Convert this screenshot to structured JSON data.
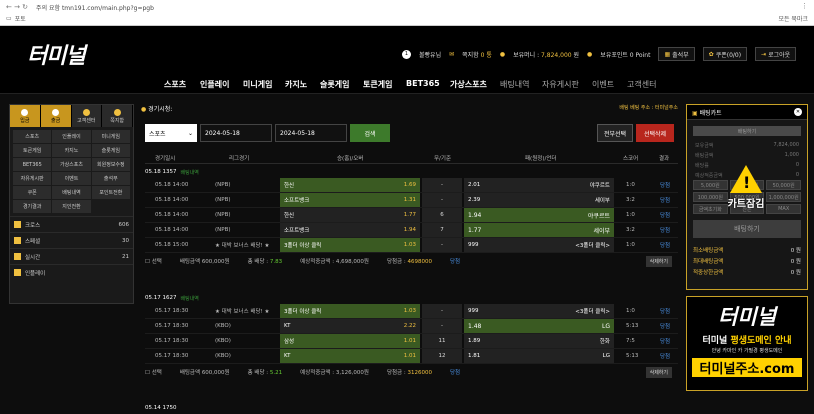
{
  "browser": {
    "url": "주의 요함   tmn191.com/main.php?g=pgb",
    "bookmark": "포토",
    "bookmark_right": "모든 북마크"
  },
  "header": {
    "logo": "터미널",
    "level": "1",
    "user": "볼빵유",
    "user_suffix": "님",
    "msg_label": "쪽지함",
    "msg_count": "0 통",
    "money_label": "보유머니 :",
    "money": "7,824,000",
    "money_unit": "원",
    "point_label": "보유포인트 0 Point",
    "buttons": [
      "출석부",
      "쿠폰(0/0)",
      "로그아웃"
    ]
  },
  "menu": {
    "items": [
      "스포츠",
      "인플레이",
      "미니게임",
      "카지노",
      "슬롯게임",
      "토큰게임",
      "BET365",
      "가상스포츠",
      "배팅내역",
      "자유게시판",
      "이벤트",
      "고객센터"
    ]
  },
  "sidebar": {
    "top": [
      "입금",
      "출금",
      "고객센터",
      "쪽지함"
    ],
    "grid": [
      "스포츠",
      "인플레이",
      "미니게임",
      "토큰게임",
      "카지노",
      "슬롯게임",
      "BET365",
      "가상스포츠",
      "회원정보수정",
      "자유게시판",
      "이벤트",
      "출석부",
      "쿠폰",
      "배팅내역",
      "포인트전환",
      "경기결과",
      "지인전환"
    ],
    "list": [
      {
        "label": "크로스",
        "count": "606"
      },
      {
        "label": "스페셜",
        "count": "30"
      },
      {
        "label": "실시간",
        "count": "21"
      },
      {
        "label": "인플레이",
        "count": ""
      }
    ]
  },
  "main": {
    "title_prefix": "경기시청:",
    "title_suffix": "",
    "notice": "배팅 베팅 주소 : 터미널주소",
    "filter": {
      "sport": "스포츠",
      "date_from": "2024-05-18",
      "date_to": "2024-05-18",
      "search": "검색",
      "select_all": "전부선택",
      "delete_selected": "선택삭제"
    },
    "columns": [
      "경기일시",
      "리그경기",
      "승(홈)/오버",
      "무/기준",
      "패(원정)/언더",
      "스코어",
      "결과"
    ],
    "groups": [
      {
        "title": "05.18 1357",
        "badge": "배팅내역",
        "rows": [
          {
            "date": "05.18 14:00",
            "league": "(NPB)",
            "home": "한신",
            "ho": "1.69",
            "draw": "-",
            "away": "2.01",
            "aname": "야쿠르트",
            "score": "1:0",
            "res": "당첨",
            "sel": "home"
          },
          {
            "date": "05.18 14:00",
            "league": "(NPB)",
            "home": "소프트뱅크",
            "ho": "1.31",
            "draw": "-",
            "away": "2.39",
            "aname": "세이부",
            "score": "3:2",
            "res": "당첨",
            "sel": "home"
          },
          {
            "date": "05.18 14:00",
            "league": "(NPB)",
            "home": "한신",
            "ho": "1.77",
            "draw": "6",
            "away": "1.94",
            "aname": "야쿠르트",
            "score": "1:0",
            "res": "당첨",
            "sel": "away"
          },
          {
            "date": "05.18 14:00",
            "league": "(NPB)",
            "home": "소프트뱅크",
            "ho": "1.94",
            "draw": "7",
            "away": "1.77",
            "aname": "세이부",
            "score": "3:2",
            "res": "당첨",
            "sel": "away"
          },
          {
            "date": "05.18 15:00",
            "league": "★ 대박 보너스 배당! ★",
            "home": "3폴더 이상 클릭",
            "ho": "1.03",
            "draw": "-",
            "away": "999",
            "aname": "<3폴더 클릭>",
            "score": "1:0",
            "res": "당첨",
            "sel": "home"
          }
        ],
        "summary": {
          "select": "선택",
          "bet_label": "배팅금액",
          "bet": "600,000원",
          "odds_label": "총 배당 :",
          "odds": "7.83",
          "exp_label": "예상적중금액 :",
          "exp": "4,698,000원",
          "win_label": "당첨금 :",
          "win": "4698000",
          "result": "당첨",
          "del": "삭제하기"
        }
      },
      {
        "title": "05.17 1627",
        "badge": "배팅내역",
        "rows": [
          {
            "date": "05.17 18:30",
            "league": "★ 대박 보너스 배당! ★",
            "home": "3폴더 이상 클릭",
            "ho": "1.03",
            "draw": "-",
            "away": "999",
            "aname": "<3폴더 클릭>",
            "score": "1:0",
            "res": "당첨",
            "sel": "home"
          },
          {
            "date": "05.17 18:30",
            "league": "(KBO)",
            "home": "KT",
            "ho": "2.22",
            "draw": "-",
            "away": "1.48",
            "aname": "LG",
            "score": "5:13",
            "res": "당첨",
            "sel": "away"
          },
          {
            "date": "05.17 18:30",
            "league": "(KBO)",
            "home": "삼성",
            "ho": "1.01",
            "draw": "11",
            "away": "1.89",
            "aname": "한화",
            "score": "7:5",
            "res": "당첨",
            "sel": "home"
          },
          {
            "date": "05.17 18:30",
            "league": "(KBO)",
            "home": "KT",
            "ho": "1.01",
            "draw": "12",
            "away": "1.81",
            "aname": "LG",
            "score": "5:13",
            "res": "당첨",
            "sel": "home"
          }
        ],
        "summary": {
          "select": "선택",
          "bet_label": "배팅금액",
          "bet": "600,000원",
          "odds_label": "총 배당 :",
          "odds": "5.21",
          "exp_label": "예상적중금액 :",
          "exp": "3,126,000원",
          "win_label": "당첨금 :",
          "win": "3126000",
          "result": "당첨",
          "del": "삭제하기"
        }
      }
    ],
    "next_group": "05.14 1750"
  },
  "betslip": {
    "title": "배팅카트",
    "tab": "배팅하기",
    "lines": [
      {
        "l": "보유금액",
        "v": "7,824,000"
      },
      {
        "l": "배팅금액",
        "v": "1,000"
      },
      {
        "l": "배당률",
        "v": "0"
      },
      {
        "l": "예상적중금액",
        "v": "0"
      }
    ],
    "buttons": [
      "5,000원",
      "10,000원",
      "50,000원",
      "100,000원",
      "500,000원",
      "1,000,000원",
      "금액초기화",
      "잔돈",
      "MAX"
    ],
    "submit": "배팅하기",
    "warn": "카트잠김",
    "stats": [
      {
        "l": "최소배팅금액",
        "v": "0 원"
      },
      {
        "l": "최대배팅금액",
        "v": "0 원"
      },
      {
        "l": "적중상한금액",
        "v": "0 원"
      }
    ]
  },
  "ad": {
    "logo": "터미널",
    "line1a": "터미널",
    "line1b": "평생도메인 안내",
    "line2": "안녕 카마인 카 가필경 평생도메인",
    "domain": "터미널주소.com"
  },
  "colors": {
    "accent": "#f0c040",
    "selected": "#3a5a22",
    "win": "#4a8fe0"
  }
}
